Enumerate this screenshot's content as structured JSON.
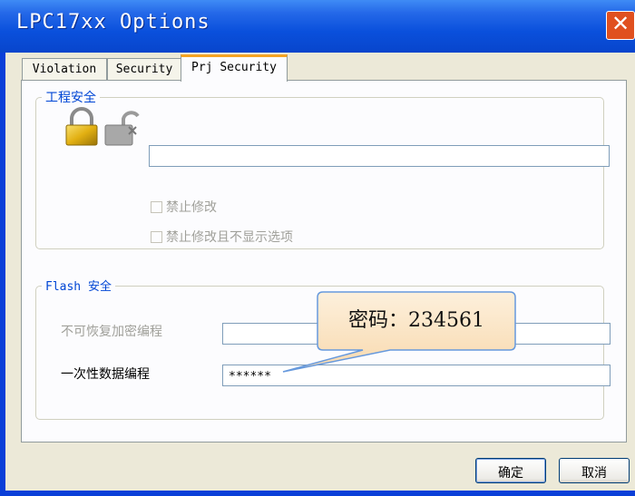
{
  "window": {
    "title": "LPC17xx Options",
    "close_icon": "close-icon",
    "title_color": "#ffffff",
    "titlebar_color": "#0a50dc"
  },
  "tabs": [
    {
      "label": "Violation",
      "active": false
    },
    {
      "label": "Security",
      "active": false
    },
    {
      "label": "Prj Security",
      "active": true
    }
  ],
  "project_security": {
    "legend": "工程安全",
    "icons": [
      "locked-padlock-icon",
      "unlocked-padlock-icon"
    ],
    "password_value": "",
    "checkboxes": [
      {
        "label": "禁止修改",
        "checked": false,
        "enabled": false
      },
      {
        "label": "禁止修改且不显示选项",
        "checked": false,
        "enabled": false
      }
    ]
  },
  "flash_security": {
    "legend": "Flash 安全",
    "rows": [
      {
        "label": "不可恢复加密编程",
        "value": "",
        "enabled": false
      },
      {
        "label": "一次性数据编程",
        "value": "******",
        "enabled": true
      }
    ]
  },
  "callout": {
    "text": "密码：234561",
    "fill": "#fce6c6",
    "stroke": "#6699dd"
  },
  "buttons": {
    "ok": "确定",
    "cancel": "取消"
  },
  "colors": {
    "accent": "#0046d5",
    "dialog_bg": "#ece9d8",
    "tab_highlight": "#f5a422"
  }
}
